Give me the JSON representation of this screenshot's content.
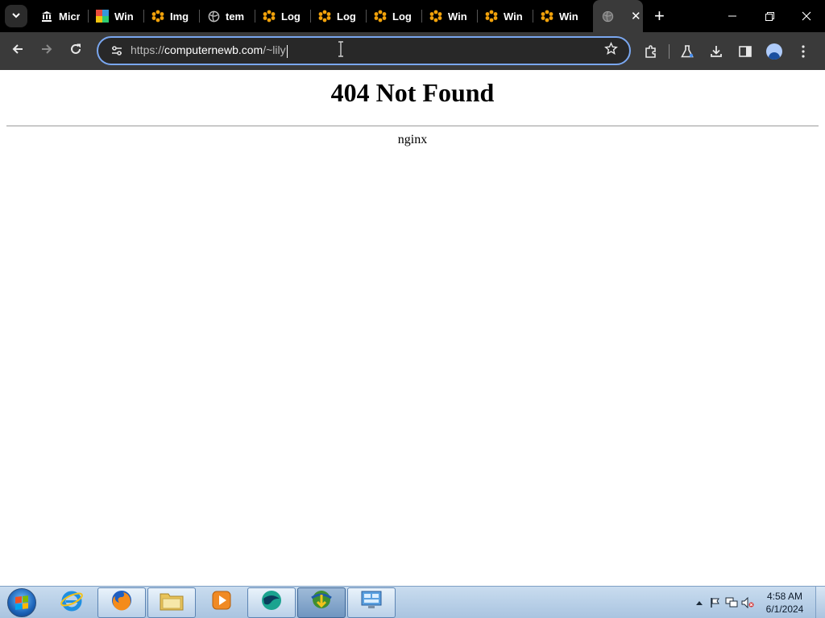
{
  "browser": {
    "tabs": [
      {
        "title": "Micr",
        "icon": "museum-icon"
      },
      {
        "title": "Win",
        "icon": "colorful-grid-icon"
      },
      {
        "title": "Img",
        "icon": "orange-flower-icon"
      },
      {
        "title": "tem",
        "icon": "globe-icon"
      },
      {
        "title": "Log",
        "icon": "orange-flower-icon"
      },
      {
        "title": "Log",
        "icon": "orange-flower-icon"
      },
      {
        "title": "Log",
        "icon": "orange-flower-icon"
      },
      {
        "title": "Win",
        "icon": "orange-flower-icon"
      },
      {
        "title": "Win",
        "icon": "orange-flower-icon"
      },
      {
        "title": "Win",
        "icon": "orange-flower-icon"
      }
    ],
    "active_tab": {
      "icon": "globe-icon"
    },
    "address_bar": {
      "scheme": "https://",
      "host": "computernewb.com",
      "path": "/~lily"
    }
  },
  "page": {
    "heading": "404 Not Found",
    "server": "nginx"
  },
  "taskbar": {
    "apps": [
      {
        "name": "internet-explorer",
        "state": "pinned"
      },
      {
        "name": "firefox",
        "state": "running"
      },
      {
        "name": "file-explorer",
        "state": "running"
      },
      {
        "name": "media-player",
        "state": "pinned"
      },
      {
        "name": "chrome-like-app",
        "state": "running"
      },
      {
        "name": "download-manager",
        "state": "active"
      },
      {
        "name": "control-panel",
        "state": "running"
      }
    ],
    "clock": {
      "time": "4:58 AM",
      "date": "6/1/2024"
    }
  },
  "colors": {
    "tabstrip_bg": "#000000",
    "toolbar_bg": "#3a3a3a",
    "omnibox_focus_border": "#7aa7f0",
    "flower_orange": "#f2a20a"
  }
}
